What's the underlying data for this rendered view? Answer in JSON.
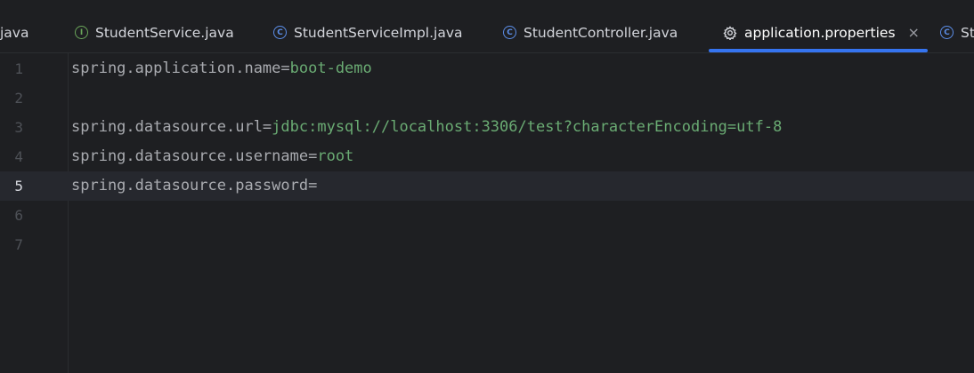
{
  "tabs": [
    {
      "label": "java",
      "icon": "none",
      "active": false
    },
    {
      "label": "StudentService.java",
      "icon": "interface-icon",
      "icon_glyph": "I",
      "active": false
    },
    {
      "label": "StudentServiceImpl.java",
      "icon": "class-icon",
      "icon_glyph": "C",
      "active": false
    },
    {
      "label": "StudentController.java",
      "icon": "class-icon",
      "icon_glyph": "C",
      "active": false
    },
    {
      "label": "application.properties",
      "icon": "gear-icon",
      "active": true,
      "close": "×"
    },
    {
      "label": "St",
      "icon": "class-icon",
      "icon_glyph": "C",
      "active": false
    }
  ],
  "editor": {
    "current_line": 5,
    "lines": [
      {
        "number": "1",
        "key": "spring.application.name=",
        "value": "boot-demo"
      },
      {
        "number": "2",
        "key": "",
        "value": ""
      },
      {
        "number": "3",
        "key": "spring.datasource.url=",
        "value": "jdbc:mysql://localhost:3306/test?characterEncoding=utf-8"
      },
      {
        "number": "4",
        "key": "spring.datasource.username=",
        "value": "root"
      },
      {
        "number": "5",
        "key": "spring.datasource.password=",
        "value": ""
      },
      {
        "number": "6",
        "key": "",
        "value": ""
      },
      {
        "number": "7",
        "key": "",
        "value": ""
      }
    ]
  },
  "colors": {
    "background": "#1e1f22",
    "accent": "#3574f0",
    "property_value": "#6aab73",
    "property_key": "#a9abb0",
    "interface_icon": "#6aa65a",
    "class_icon": "#5c8ee8"
  }
}
